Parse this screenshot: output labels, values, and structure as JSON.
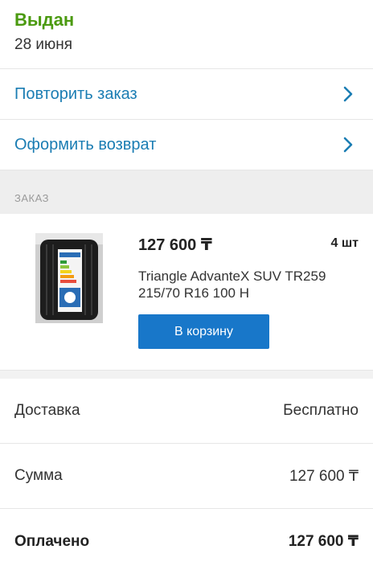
{
  "order_status": {
    "title": "Выдан",
    "date": "28 июня"
  },
  "actions": [
    {
      "label": "Повторить заказ"
    },
    {
      "label": "Оформить возврат"
    }
  ],
  "colors": {
    "status": "#4b9a10",
    "link": "#1b7db3",
    "button": "#1877c9"
  },
  "section": {
    "label": "ЗАКАЗ"
  },
  "product": {
    "price": "127 600 ₸",
    "quantity": "4 шт",
    "name": "Triangle AdvanteX SUV TR259 215/70 R16 100 H",
    "add_to_cart_label": "В корзину",
    "image_icon": "tire-image"
  },
  "summary": {
    "delivery": {
      "label": "Доставка",
      "value": "Бесплатно"
    },
    "total": {
      "label": "Сумма",
      "value": "127 600 ₸"
    },
    "paid": {
      "label": "Оплачено",
      "value": "127 600 ₸"
    }
  }
}
